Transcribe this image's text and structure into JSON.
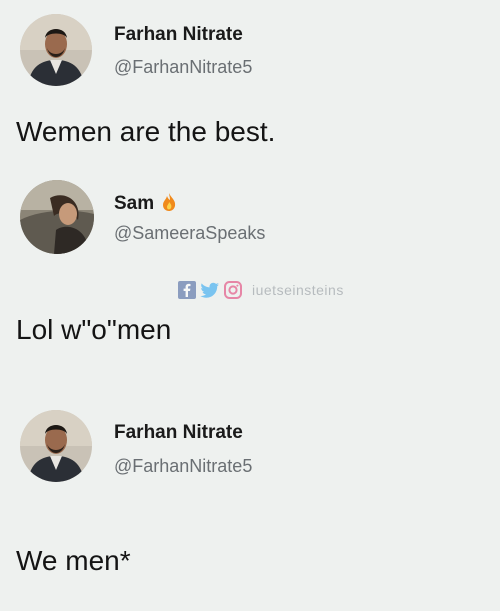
{
  "tweets": [
    {
      "name": "Farhan Nitrate",
      "handle": "@FarhanNitrate5",
      "text": "Wemen are the best.",
      "avatar_icon": "man-portrait-avatar"
    },
    {
      "name": "Sam",
      "handle": "@SameeraSpeaks",
      "text": "Lol w\"o\"men",
      "avatar_icon": "woman-in-car-avatar",
      "name_emoji": "fire-icon"
    },
    {
      "name": "Farhan Nitrate",
      "handle": "@FarhanNitrate5",
      "text": "We men*",
      "avatar_icon": "man-portrait-avatar"
    }
  ],
  "watermark": {
    "text": "iuetseinsteins",
    "icons": [
      "facebook-icon",
      "twitter-icon",
      "instagram-icon"
    ],
    "colors": {
      "facebook": "#3b5998",
      "twitter": "#1da1f2",
      "instagram": "#e1306c"
    }
  }
}
